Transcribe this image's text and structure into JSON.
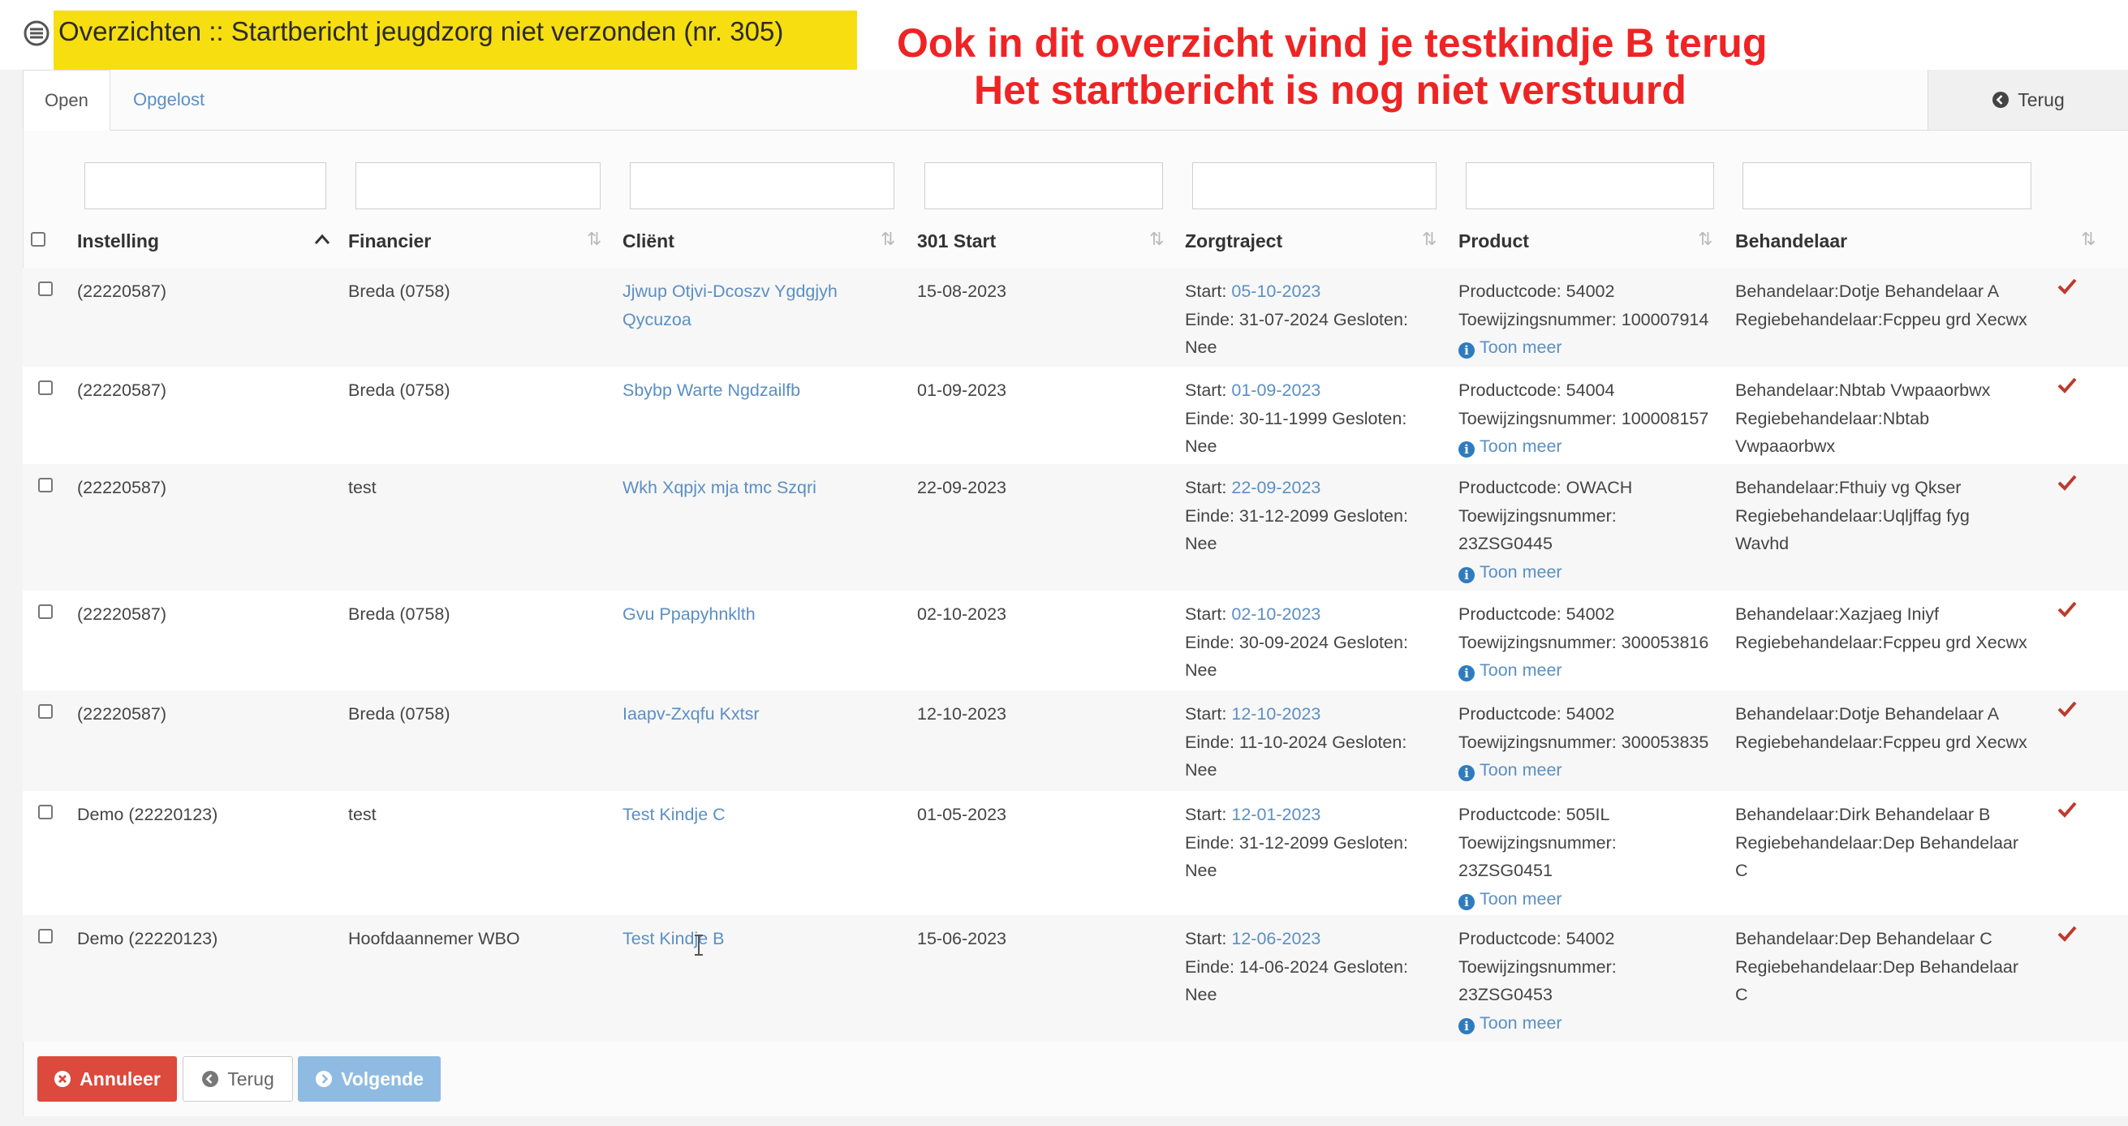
{
  "page": {
    "title": "Overzichten :: Startbericht jeugdzorg niet verzonden (nr. 305)",
    "annotation_line1": "Ook in dit overzicht vind je testkindje B terug",
    "annotation_line2": "Het startbericht is nog niet verstuurd"
  },
  "tabs": [
    {
      "label": "Open",
      "active": true
    },
    {
      "label": "Opgelost",
      "active": false
    }
  ],
  "toolbar": {
    "terug_label": "Terug"
  },
  "columns": [
    "Instelling",
    "Financier",
    "Cliënt",
    "301 Start",
    "Zorgtraject",
    "Product",
    "Behandelaar"
  ],
  "rows": [
    {
      "instelling": "(22220587)",
      "financier": "Breda (0758)",
      "client": [
        "Jjwup Otjvi-Dcoszv Ygdgjyh",
        "Qycuzoa"
      ],
      "start301": "15-08-2023",
      "zorg_start_label": "Start:",
      "zorg_start": "05-10-2023",
      "zorg_line2": "Einde: 31-07-2024 Gesloten:",
      "zorg_line3": "Nee",
      "product": [
        "Productcode: 54002",
        "Toewijzingsnummer: 100007914"
      ],
      "toon_meer": "Toon meer",
      "behandelaar": [
        "Behandelaar:Dotje Behandelaar A",
        "Regiebehandelaar:Fcppeu grd Xecwx"
      ]
    },
    {
      "instelling": "(22220587)",
      "financier": "Breda (0758)",
      "client": [
        "Sbybp Warte Ngdzailfb"
      ],
      "start301": "01-09-2023",
      "zorg_start_label": "Start:",
      "zorg_start": "01-09-2023",
      "zorg_line2": "Einde: 30-11-1999 Gesloten:",
      "zorg_line3": "Nee",
      "product": [
        "Productcode: 54004",
        "Toewijzingsnummer: 100008157"
      ],
      "toon_meer": "Toon meer",
      "behandelaar": [
        "Behandelaar:Nbtab Vwpaaorbwx",
        "Regiebehandelaar:Nbtab",
        "Vwpaaorbwx"
      ]
    },
    {
      "instelling": "(22220587)",
      "financier": "test",
      "client": [
        "Wkh Xqpjx mja tmc Szqri"
      ],
      "start301": "22-09-2023",
      "zorg_start_label": "Start:",
      "zorg_start": "22-09-2023",
      "zorg_line2": "Einde: 31-12-2099 Gesloten:",
      "zorg_line3": "Nee",
      "product": [
        "Productcode: OWACH",
        "Toewijzingsnummer:",
        "23ZSG0445"
      ],
      "toon_meer": "Toon meer",
      "behandelaar": [
        "Behandelaar:Fthuiy vg Qkser",
        "Regiebehandelaar:Uqljffag fyg",
        "Wavhd"
      ]
    },
    {
      "instelling": "(22220587)",
      "financier": "Breda (0758)",
      "client": [
        "Gvu Ppapyhnklth"
      ],
      "start301": "02-10-2023",
      "zorg_start_label": "Start:",
      "zorg_start": "02-10-2023",
      "zorg_line2": "Einde: 30-09-2024 Gesloten:",
      "zorg_line3": "Nee",
      "product": [
        "Productcode: 54002",
        "Toewijzingsnummer: 300053816"
      ],
      "toon_meer": "Toon meer",
      "behandelaar": [
        "Behandelaar:Xazjaeg Iniyf",
        "Regiebehandelaar:Fcppeu grd Xecwx"
      ]
    },
    {
      "instelling": "(22220587)",
      "financier": "Breda (0758)",
      "client": [
        "Iaapv-Zxqfu Kxtsr"
      ],
      "start301": "12-10-2023",
      "zorg_start_label": "Start:",
      "zorg_start": "12-10-2023",
      "zorg_line2": "Einde: 11-10-2024 Gesloten:",
      "zorg_line3": "Nee",
      "product": [
        "Productcode: 54002",
        "Toewijzingsnummer: 300053835"
      ],
      "toon_meer": "Toon meer",
      "behandelaar": [
        "Behandelaar:Dotje Behandelaar A",
        "Regiebehandelaar:Fcppeu grd Xecwx"
      ]
    },
    {
      "instelling": "Demo (22220123)",
      "financier": "test",
      "client": [
        "Test Kindje C"
      ],
      "start301": "01-05-2023",
      "zorg_start_label": "Start:",
      "zorg_start": "12-01-2023",
      "zorg_line2": "Einde: 31-12-2099 Gesloten:",
      "zorg_line3": "Nee",
      "product": [
        "Productcode: 505IL",
        "Toewijzingsnummer:",
        "23ZSG0451"
      ],
      "toon_meer": "Toon meer",
      "behandelaar": [
        "Behandelaar:Dirk Behandelaar B",
        "Regiebehandelaar:Dep Behandelaar",
        "C"
      ]
    },
    {
      "instelling": "Demo (22220123)",
      "financier": "Hoofdaannemer WBO",
      "client": [
        "Test Kindje B"
      ],
      "start301": "15-06-2023",
      "zorg_start_label": "Start:",
      "zorg_start": "12-06-2023",
      "zorg_line2": "Einde: 14-06-2024 Gesloten:",
      "zorg_line3": "Nee",
      "product": [
        "Productcode: 54002",
        "Toewijzingsnummer:",
        "23ZSG0453"
      ],
      "toon_meer": "Toon meer",
      "behandelaar": [
        "Behandelaar:Dep Behandelaar C",
        "Regiebehandelaar:Dep Behandelaar",
        "C"
      ]
    }
  ],
  "footer": {
    "annuleer_label": "Annuleer",
    "terug_label": "Terug",
    "volgende_label": "Volgende"
  },
  "colors": {
    "link": "#5b8fc3",
    "check": "#c0392b",
    "highlight": "#f7de10",
    "annotation": "#ee2424",
    "danger": "#db4a3c",
    "primary_disabled": "#8fbbe2"
  }
}
